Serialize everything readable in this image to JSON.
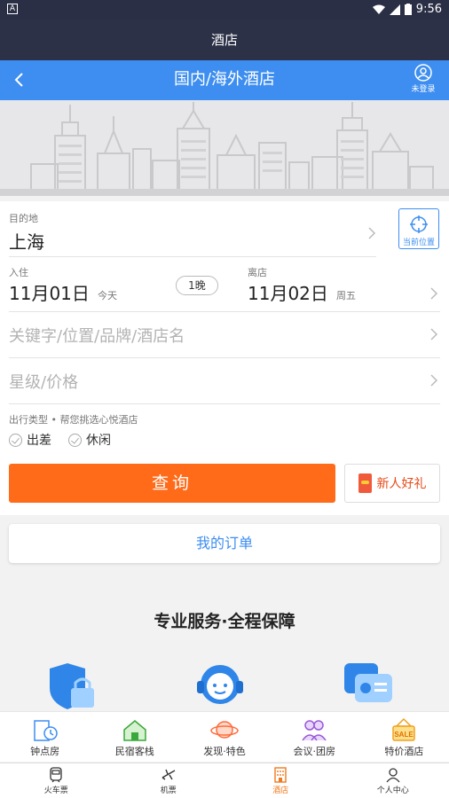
{
  "status_bar": {
    "time": "9:56"
  },
  "app_title": "酒店",
  "nav": {
    "title": "国内/海外酒店",
    "user_label": "未登录"
  },
  "destination": {
    "label": "目的地",
    "value": "上海",
    "locate_label": "当前位置"
  },
  "dates": {
    "checkin_label": "入住",
    "checkin_date": "11月01日",
    "checkin_day": "今天",
    "nights": "1晚",
    "checkout_label": "离店",
    "checkout_date": "11月02日",
    "checkout_day": "周五"
  },
  "keyword_placeholder": "关键字/位置/品牌/酒店名",
  "star_price_placeholder": "星级/价格",
  "travel_type": {
    "label": "出行类型 • 帮您挑选心悦酒店",
    "options": [
      "出差",
      "休闲"
    ]
  },
  "search_label": "查询",
  "gift_label": "新人好礼",
  "orders_label": "我的订单",
  "service_title": "专业服务·全程保障",
  "categories": [
    "钟点房",
    "民宿客栈",
    "发现·特色",
    "会议·团房",
    "特价酒店"
  ],
  "tabs": [
    {
      "label": "火车票",
      "active": false
    },
    {
      "label": "机票",
      "active": false
    },
    {
      "label": "酒店",
      "active": true
    },
    {
      "label": "个人中心",
      "active": false
    }
  ],
  "colors": {
    "nav_blue": "#3d8ef0",
    "search_orange": "#ff6b19",
    "title_dark": "#2d3147",
    "active_tab": "#f07a1f"
  },
  "icons": [
    "wifi-icon",
    "signal-icon",
    "battery-icon",
    "back-icon",
    "user-icon",
    "locate-icon",
    "chevron-right-icon",
    "shield-lock-icon",
    "customer-service-icon",
    "chat-card-icon",
    "hourly-room-icon",
    "homestay-icon",
    "planet-icon",
    "meeting-icon",
    "sale-icon",
    "train-icon",
    "plane-icon",
    "hotel-icon",
    "person-icon"
  ]
}
